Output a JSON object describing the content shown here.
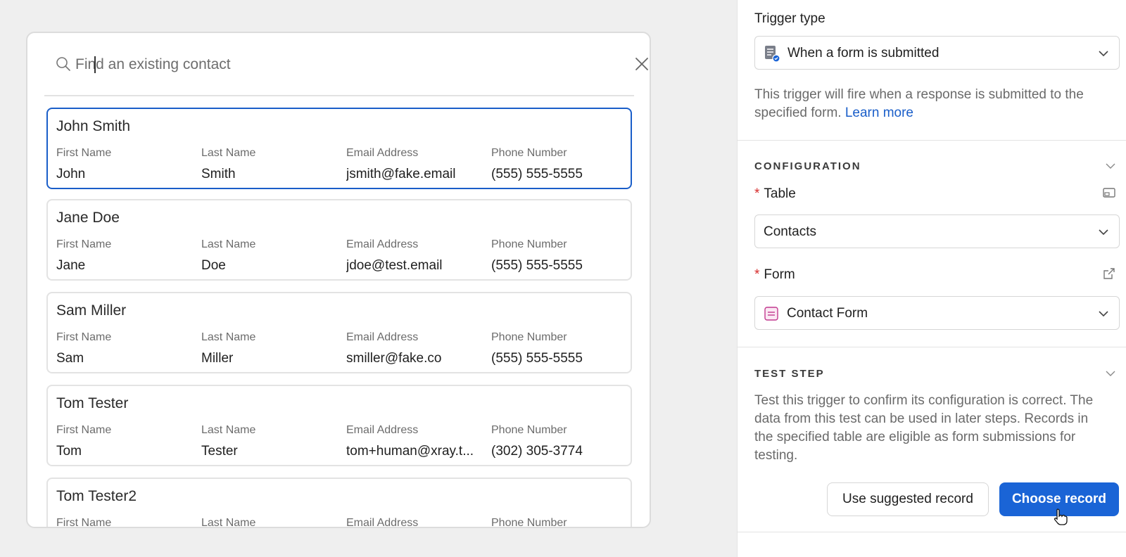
{
  "search": {
    "placeholder": "Find an existing contact"
  },
  "field_labels": {
    "first_name": "First Name",
    "last_name": "Last Name",
    "email": "Email Address",
    "phone": "Phone Number"
  },
  "contacts": [
    {
      "title": "John Smith",
      "first": "John",
      "last": "Smith",
      "email": "jsmith@fake.email",
      "phone": "(555) 555-5555",
      "selected": true
    },
    {
      "title": "Jane Doe",
      "first": "Jane",
      "last": "Doe",
      "email": "jdoe@test.email",
      "phone": "(555) 555-5555",
      "selected": false
    },
    {
      "title": "Sam Miller",
      "first": "Sam",
      "last": "Miller",
      "email": "smiller@fake.co",
      "phone": "(555) 555-5555",
      "selected": false
    },
    {
      "title": "Tom Tester",
      "first": "Tom",
      "last": "Tester",
      "email": "tom+human@xray.t...",
      "phone": "(302) 305-3774",
      "selected": false
    },
    {
      "title": "Tom Tester2",
      "first": "",
      "last": "",
      "email": "",
      "phone": "",
      "selected": false
    }
  ],
  "panel": {
    "trigger_type_label": "Trigger type",
    "trigger_type_value": "When a form is submitted",
    "trigger_help": "This trigger will fire when a response is submitted to the specified form.",
    "learn_more": "Learn more",
    "configuration_heading": "CONFIGURATION",
    "table_label": "Table",
    "table_value": "Contacts",
    "form_label": "Form",
    "form_value": "Contact Form",
    "test_step_heading": "TEST STEP",
    "test_help": "Test this trigger to confirm its configuration is correct. The data from this test can be used in later steps. Records in the specified table are eligible as form submissions for testing.",
    "use_suggested_label": "Use suggested record",
    "choose_record_label": "Choose record"
  },
  "icons": {
    "search": "search-icon",
    "close": "close-icon",
    "form_trigger": "form-trigger-icon",
    "chevron": "chevron-down-icon",
    "expand": "expand-icon",
    "external_link": "external-link-icon",
    "form": "form-icon",
    "cursor": "hand-cursor-icon"
  },
  "colors": {
    "accent": "#1a64d6",
    "selected_border": "#1a5ec9",
    "required": "#d62b2b",
    "form_icon": "#c2398f"
  }
}
